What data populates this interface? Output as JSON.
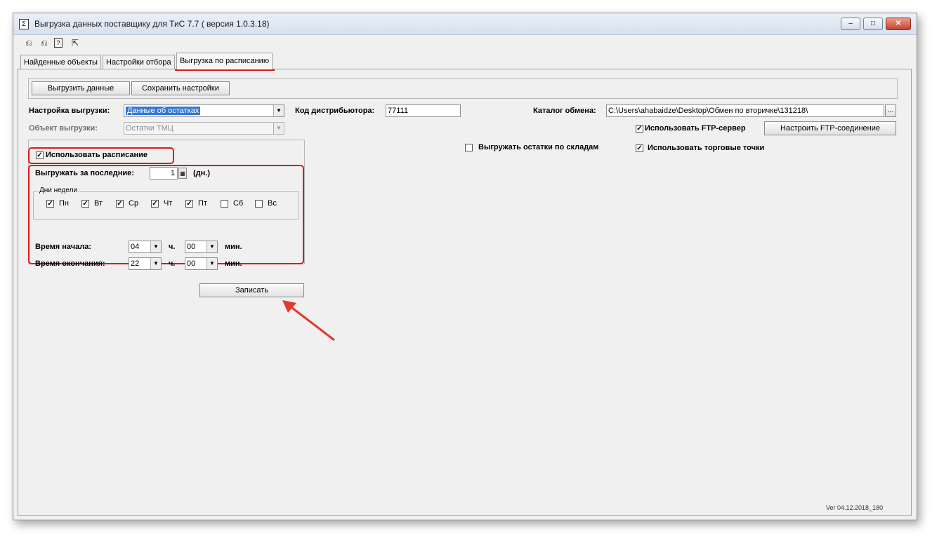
{
  "window": {
    "title": "Выгрузка данных поставщику для ТиС 7.7 ( версия 1.0.3.18)",
    "app_icon": "Σ",
    "controls": {
      "minimize": "–",
      "maximize": "□",
      "close": "✕"
    }
  },
  "toolbar": {
    "icons": [
      "⎌",
      "⎌",
      "?",
      "⇱"
    ]
  },
  "tabs": [
    {
      "label": "Найденные объекты"
    },
    {
      "label": "Настройки отбора"
    },
    {
      "label": "Выгрузка по расписанию"
    }
  ],
  "buttons": {
    "export_data": "Выгрузить данные",
    "save_settings": "Сохранить настройки",
    "configure_ftp": "Настроить FTP-соединение",
    "browse": "...",
    "write": "Записать"
  },
  "form": {
    "export_setting_label": "Настройка выгрузки:",
    "export_setting_value": "Данные об остатках",
    "export_object_label": "Объект выгрузки:",
    "export_object_value": "Остатки ТМЦ",
    "distributor_code_label": "Код дистрибьютора:",
    "distributor_code_value": "77111",
    "exchange_catalog_label": "Каталог обмена:",
    "exchange_catalog_value": "C:\\Users\\ahabaidze\\Desktop\\Обмен по вторичке\\131218\\",
    "use_ftp_label": "Использовать FTP-сервер",
    "use_ftp_checked": true,
    "export_by_warehouses_label": "Выгружать остатки по складам",
    "export_by_warehouses_checked": false,
    "use_trade_points_label": "Использовать торговые точки",
    "use_trade_points_checked": true
  },
  "schedule": {
    "use_schedule_label": "Использовать расписание",
    "use_schedule_checked": true,
    "export_last_label": "Выгружать за последние:",
    "export_last_value": "1",
    "days_unit": "(дн.)",
    "weekdays_legend": "Дни недели",
    "weekdays": [
      {
        "label": "Пн",
        "checked": true
      },
      {
        "label": "Вт",
        "checked": true
      },
      {
        "label": "Ср",
        "checked": true
      },
      {
        "label": "Чт",
        "checked": true
      },
      {
        "label": "Пт",
        "checked": true
      },
      {
        "label": "Сб",
        "checked": false
      },
      {
        "label": "Вс",
        "checked": false
      }
    ],
    "start_time_label": "Время начала:",
    "start_hour": "04",
    "start_min": "00",
    "end_time_label": "Время окончания:",
    "end_hour": "22",
    "end_min": "00",
    "hour_unit": "ч.",
    "min_unit": "мин."
  },
  "footer": {
    "version": "Ver 04.12.2018_180"
  },
  "colors": {
    "highlight": "#e01818",
    "selection": "#3178d6",
    "arrow": "#e03a2e"
  }
}
